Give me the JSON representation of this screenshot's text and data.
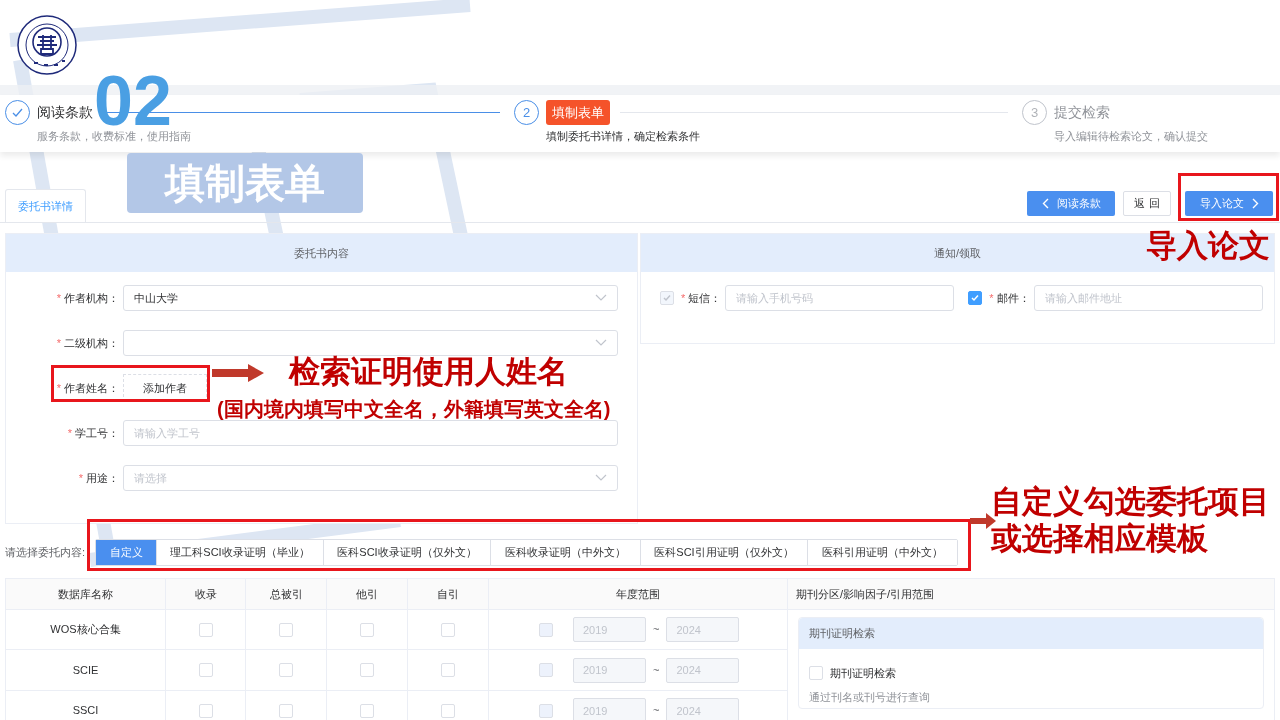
{
  "steps": [
    {
      "completed": true,
      "active": false,
      "title": "阅读条款",
      "subtitle": "服务条款，收费标准，使用指南"
    },
    {
      "completed": false,
      "active": true,
      "number": "2",
      "title": "填制表单",
      "subtitle": "填制委托书详情，确定检索条件"
    },
    {
      "completed": false,
      "active": false,
      "number": "3",
      "title": "提交检索",
      "subtitle": "导入编辑待检索论文，确认提交"
    }
  ],
  "overlay": {
    "number": "02",
    "title": "填制表单"
  },
  "tabs": [
    {
      "label": "委托书详情",
      "selected": true
    }
  ],
  "buttons": [
    {
      "kind": "back",
      "label": "阅读条款"
    },
    {
      "kind": "plain",
      "label": "返 回"
    },
    {
      "kind": "next",
      "label": "导入论文"
    }
  ],
  "form": {
    "title": "委托书内容",
    "fields": [
      {
        "kind": "select",
        "marker": "*",
        "label": "作者机构：",
        "value": "中山大学"
      },
      {
        "kind": "select",
        "marker": "*",
        "label": "二级机构："
      },
      {
        "kind": "button",
        "marker": "*",
        "label": "作者姓名：",
        "button": "添加作者"
      },
      {
        "kind": "text",
        "marker": "*",
        "label": "学工号：",
        "placeholder": "请输入学工号"
      },
      {
        "kind": "select",
        "marker": "*",
        "label": "用途：",
        "placeholder": "请选择"
      }
    ]
  },
  "notify": {
    "title": "通知/领取",
    "channels": [
      {
        "checked": true,
        "disabled": true,
        "marker": "*",
        "label": "短信：",
        "placeholder": "请输入手机号码"
      },
      {
        "checked": true,
        "disabled": false,
        "marker": "*",
        "label": "邮件：",
        "placeholder": "请输入邮件地址"
      }
    ]
  },
  "templates": {
    "label": "请选择委托内容:",
    "options": [
      {
        "label": "自定义",
        "selected": true
      },
      {
        "label": "理工科SCI收录证明（毕业）",
        "selected": false
      },
      {
        "label": "医科SCI收录证明（仅外文）",
        "selected": false
      },
      {
        "label": "医科收录证明（中外文）",
        "selected": false
      },
      {
        "label": "医科SCI引用证明（仅外文）",
        "selected": false
      },
      {
        "label": "医科引用证明（中外文）",
        "selected": false
      }
    ]
  },
  "table": {
    "columns": [
      "数据库名称",
      "收录",
      "总被引",
      "他引",
      "自引",
      "年度范围",
      "期刊分区/影响因子/引用范围"
    ],
    "rows": [
      {
        "database": "WOS核心合集",
        "checks": [
          {
            "checked": false
          },
          {
            "checked": false
          },
          {
            "checked": false
          },
          {
            "checked": false
          }
        ],
        "year_checked": false,
        "year_disabled": true,
        "year_from": "2019",
        "separator": "~",
        "year_to": "2024"
      },
      {
        "database": "SCIE",
        "checks": [
          {
            "checked": false
          },
          {
            "checked": false
          },
          {
            "checked": false
          },
          {
            "checked": false
          }
        ],
        "year_checked": false,
        "year_disabled": true,
        "year_from": "2019",
        "separator": "~",
        "year_to": "2024"
      },
      {
        "database": "SSCI",
        "checks": [
          {
            "checked": false
          },
          {
            "checked": false
          },
          {
            "checked": false
          },
          {
            "checked": false
          }
        ],
        "year_checked": false,
        "year_disabled": true,
        "year_from": "2019",
        "separator": "~",
        "year_to": "2024"
      }
    ],
    "card": {
      "title": "期刊证明检索",
      "option": {
        "label": "期刊证明检索",
        "checked": false
      },
      "hint": "通过刊名或刊号进行查询"
    }
  },
  "annotations": [
    {
      "kind": "callout",
      "text": "导入论文"
    },
    {
      "kind": "callout",
      "text": "检索证明使用人姓名"
    },
    {
      "kind": "note",
      "text": "(国内境内填写中文全名，外籍填写英文全名)"
    },
    {
      "kind": "callout",
      "text": "自定义勾选委托项目"
    },
    {
      "kind": "callout",
      "text": "或选择相应模板"
    }
  ]
}
